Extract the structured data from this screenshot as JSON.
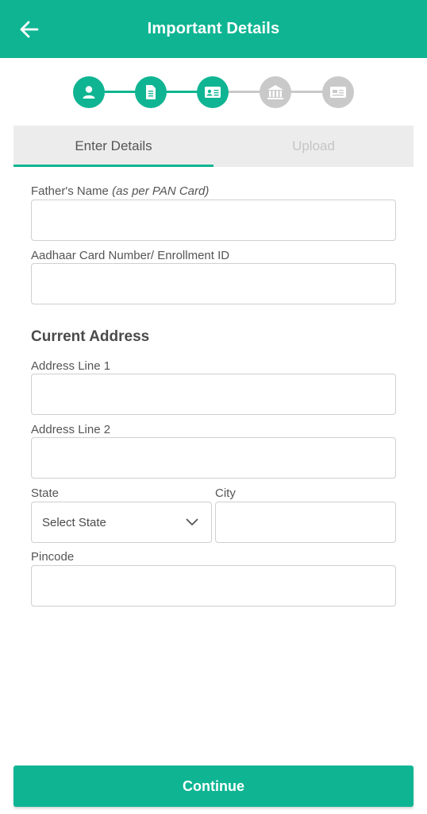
{
  "header": {
    "title": "Important Details",
    "back_icon": "arrow-left-icon",
    "background": "#0fb593"
  },
  "stepper": {
    "steps": [
      {
        "icon": "person-icon",
        "state": "active"
      },
      {
        "icon": "document-icon",
        "state": "active"
      },
      {
        "icon": "id-card-icon",
        "state": "active"
      },
      {
        "icon": "bank-icon",
        "state": "inactive"
      },
      {
        "icon": "card-icon",
        "state": "inactive"
      }
    ],
    "active_color": "#0fb593",
    "inactive_color": "#c9c9c9"
  },
  "tabs": {
    "enter_details": "Enter Details",
    "upload": "Upload",
    "selected": "Enter Details"
  },
  "form": {
    "fathers_name_label": "Father's Name",
    "fathers_name_hint": "(as per PAN Card)",
    "fathers_name_value": "",
    "aadhaar_label": "Aadhaar Card Number/ Enrollment ID",
    "aadhaar_value": "",
    "current_address_title": "Current Address",
    "address_line1_label": "Address Line 1",
    "address_line1_value": "",
    "address_line2_label": "Address Line 2",
    "address_line2_value": "",
    "state_label": "State",
    "state_select_value": "Select State",
    "city_label": "City",
    "city_value": "",
    "pincode_label": "Pincode",
    "pincode_value": ""
  },
  "footer": {
    "continue_label": "Continue"
  }
}
